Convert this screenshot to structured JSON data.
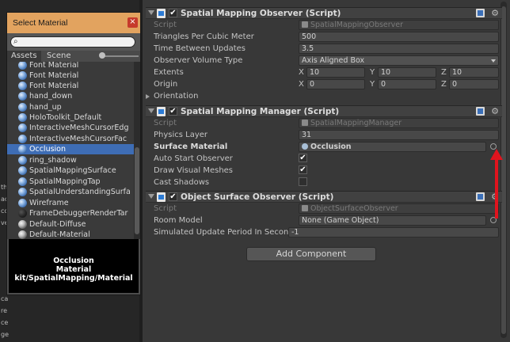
{
  "dialog": {
    "title": "Select Material",
    "close_icon": "close-icon",
    "search": {
      "value": "",
      "icon": "search-icon"
    },
    "tabs": [
      "Assets",
      "Scene"
    ],
    "active_tab": "Assets",
    "items": [
      {
        "label": "Font Material",
        "icon": "material-sphere-icon"
      },
      {
        "label": "Font Material",
        "icon": "material-sphere-icon"
      },
      {
        "label": "Font Material",
        "icon": "material-sphere-icon"
      },
      {
        "label": "hand_down",
        "icon": "material-sphere-icon"
      },
      {
        "label": "hand_up",
        "icon": "material-sphere-icon"
      },
      {
        "label": "HoloToolkit_Default",
        "icon": "material-sphere-icon"
      },
      {
        "label": "InteractiveMeshCursorEdg",
        "icon": "material-sphere-icon"
      },
      {
        "label": "InteractiveMeshCursorFac",
        "icon": "material-sphere-icon"
      },
      {
        "label": "Occlusion",
        "icon": "material-sphere-icon",
        "selected": true
      },
      {
        "label": "ring_shadow",
        "icon": "material-sphere-icon"
      },
      {
        "label": "SpatialMappingSurface",
        "icon": "material-sphere-icon"
      },
      {
        "label": "SpatialMappingTap",
        "icon": "material-sphere-icon"
      },
      {
        "label": "SpatialUnderstandingSurfa",
        "icon": "material-sphere-icon"
      },
      {
        "label": "Wireframe",
        "icon": "material-sphere-icon"
      },
      {
        "label": "FrameDebuggerRenderTar",
        "icon": "material-sphere-black-icon"
      },
      {
        "label": "Default-Diffuse",
        "icon": "material-sphere-grey-icon"
      },
      {
        "label": "Default-Material",
        "icon": "material-sphere-grey-icon"
      }
    ],
    "preview": [
      "Occlusion",
      "Material",
      "kit/SpatialMapping/Material"
    ]
  },
  "left_panel_fragments": [
    "th",
    "ac",
    "cc",
    "ve",
    "ca",
    "re",
    "ce",
    "ge"
  ],
  "components": [
    {
      "title": "Spatial Mapping Observer (Script)",
      "rows": {
        "script": {
          "label": "Script",
          "value": "SpatialMappingObserver"
        },
        "triangles": {
          "label": "Triangles Per Cubic Meter",
          "value": "500"
        },
        "time_between": {
          "label": "Time Between Updates",
          "value": "3.5"
        },
        "volume_type": {
          "label": "Observer Volume Type",
          "value": "Axis Aligned Box"
        },
        "extents": {
          "label": "Extents",
          "x": "10",
          "y": "10",
          "z": "10"
        },
        "origin": {
          "label": "Origin",
          "x": "0",
          "y": "0",
          "z": "0"
        },
        "orientation": {
          "label": "Orientation"
        }
      }
    },
    {
      "title": "Spatial Mapping Manager (Script)",
      "rows": {
        "script": {
          "label": "Script",
          "value": "SpatialMappingManager"
        },
        "physics_layer": {
          "label": "Physics Layer",
          "value": "31"
        },
        "surface_material": {
          "label": "Surface Material",
          "value": "Occlusion"
        },
        "auto_start": {
          "label": "Auto Start Observer",
          "checked": true
        },
        "draw_visual": {
          "label": "Draw Visual Meshes",
          "checked": true
        },
        "cast_shadows": {
          "label": "Cast Shadows",
          "checked": false
        }
      }
    },
    {
      "title": "Object Surface Observer (Script)",
      "rows": {
        "script": {
          "label": "Script",
          "value": "ObjectSurfaceObserver"
        },
        "room_model": {
          "label": "Room Model",
          "value": "None (Game Object)"
        },
        "sim_period": {
          "label": "Simulated Update Period In Seconds",
          "value": "-1"
        }
      }
    }
  ],
  "axis_labels": {
    "x": "X",
    "y": "Y",
    "z": "Z"
  },
  "add_component": "Add Component",
  "check_mark": "✔",
  "colors": {
    "dialog_title": "#e2a35f",
    "selection": "#3e6db5",
    "arrow": "#e0141e"
  }
}
